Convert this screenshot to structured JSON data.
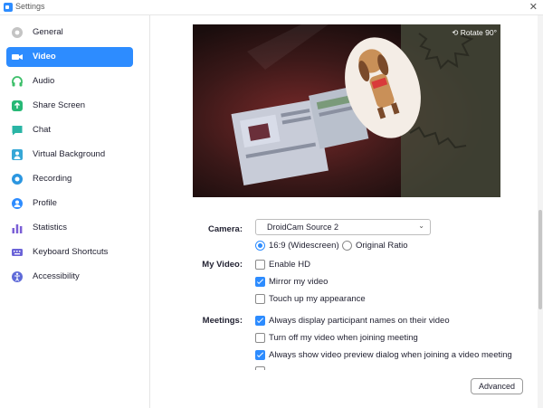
{
  "window": {
    "title": "Settings"
  },
  "sidebar": {
    "items": [
      {
        "label": "General",
        "icon": "gear-icon",
        "color": "#b0b0b0"
      },
      {
        "label": "Video",
        "icon": "video-icon",
        "color": "#2d8cff",
        "active": true
      },
      {
        "label": "Audio",
        "icon": "headphones-icon",
        "color": "#3dbf6a"
      },
      {
        "label": "Share Screen",
        "icon": "share-screen-icon",
        "color": "#27b876"
      },
      {
        "label": "Chat",
        "icon": "chat-icon",
        "color": "#2ab5a5"
      },
      {
        "label": "Virtual Background",
        "icon": "person-icon",
        "color": "#36a7d6"
      },
      {
        "label": "Recording",
        "icon": "record-icon",
        "color": "#2b96e0"
      },
      {
        "label": "Profile",
        "icon": "profile-icon",
        "color": "#2d8cff"
      },
      {
        "label": "Statistics",
        "icon": "bar-chart-icon",
        "color": "#7b5fd6"
      },
      {
        "label": "Keyboard Shortcuts",
        "icon": "keyboard-icon",
        "color": "#6b63d8"
      },
      {
        "label": "Accessibility",
        "icon": "accessibility-icon",
        "color": "#5e6ad8"
      }
    ]
  },
  "preview": {
    "rotate_label": "Rotate 90°"
  },
  "camera": {
    "label": "Camera:",
    "selected": "DroidCam Source 2",
    "ratio_options": [
      {
        "label": "16:9 (Widescreen)",
        "selected": true
      },
      {
        "label": "Original Ratio",
        "selected": false
      }
    ]
  },
  "my_video": {
    "label": "My Video:",
    "options": [
      {
        "label": "Enable HD",
        "checked": false
      },
      {
        "label": "Mirror my video",
        "checked": true
      },
      {
        "label": "Touch up my appearance",
        "checked": false
      }
    ]
  },
  "meetings": {
    "label": "Meetings:",
    "options": [
      {
        "label": "Always display participant names on their video",
        "checked": true
      },
      {
        "label": "Turn off my video when joining meeting",
        "checked": false
      },
      {
        "label": "Always show video preview dialog when joining a video meeting",
        "checked": true
      }
    ]
  },
  "advanced_label": "Advanced",
  "accent": "#2d8cff"
}
